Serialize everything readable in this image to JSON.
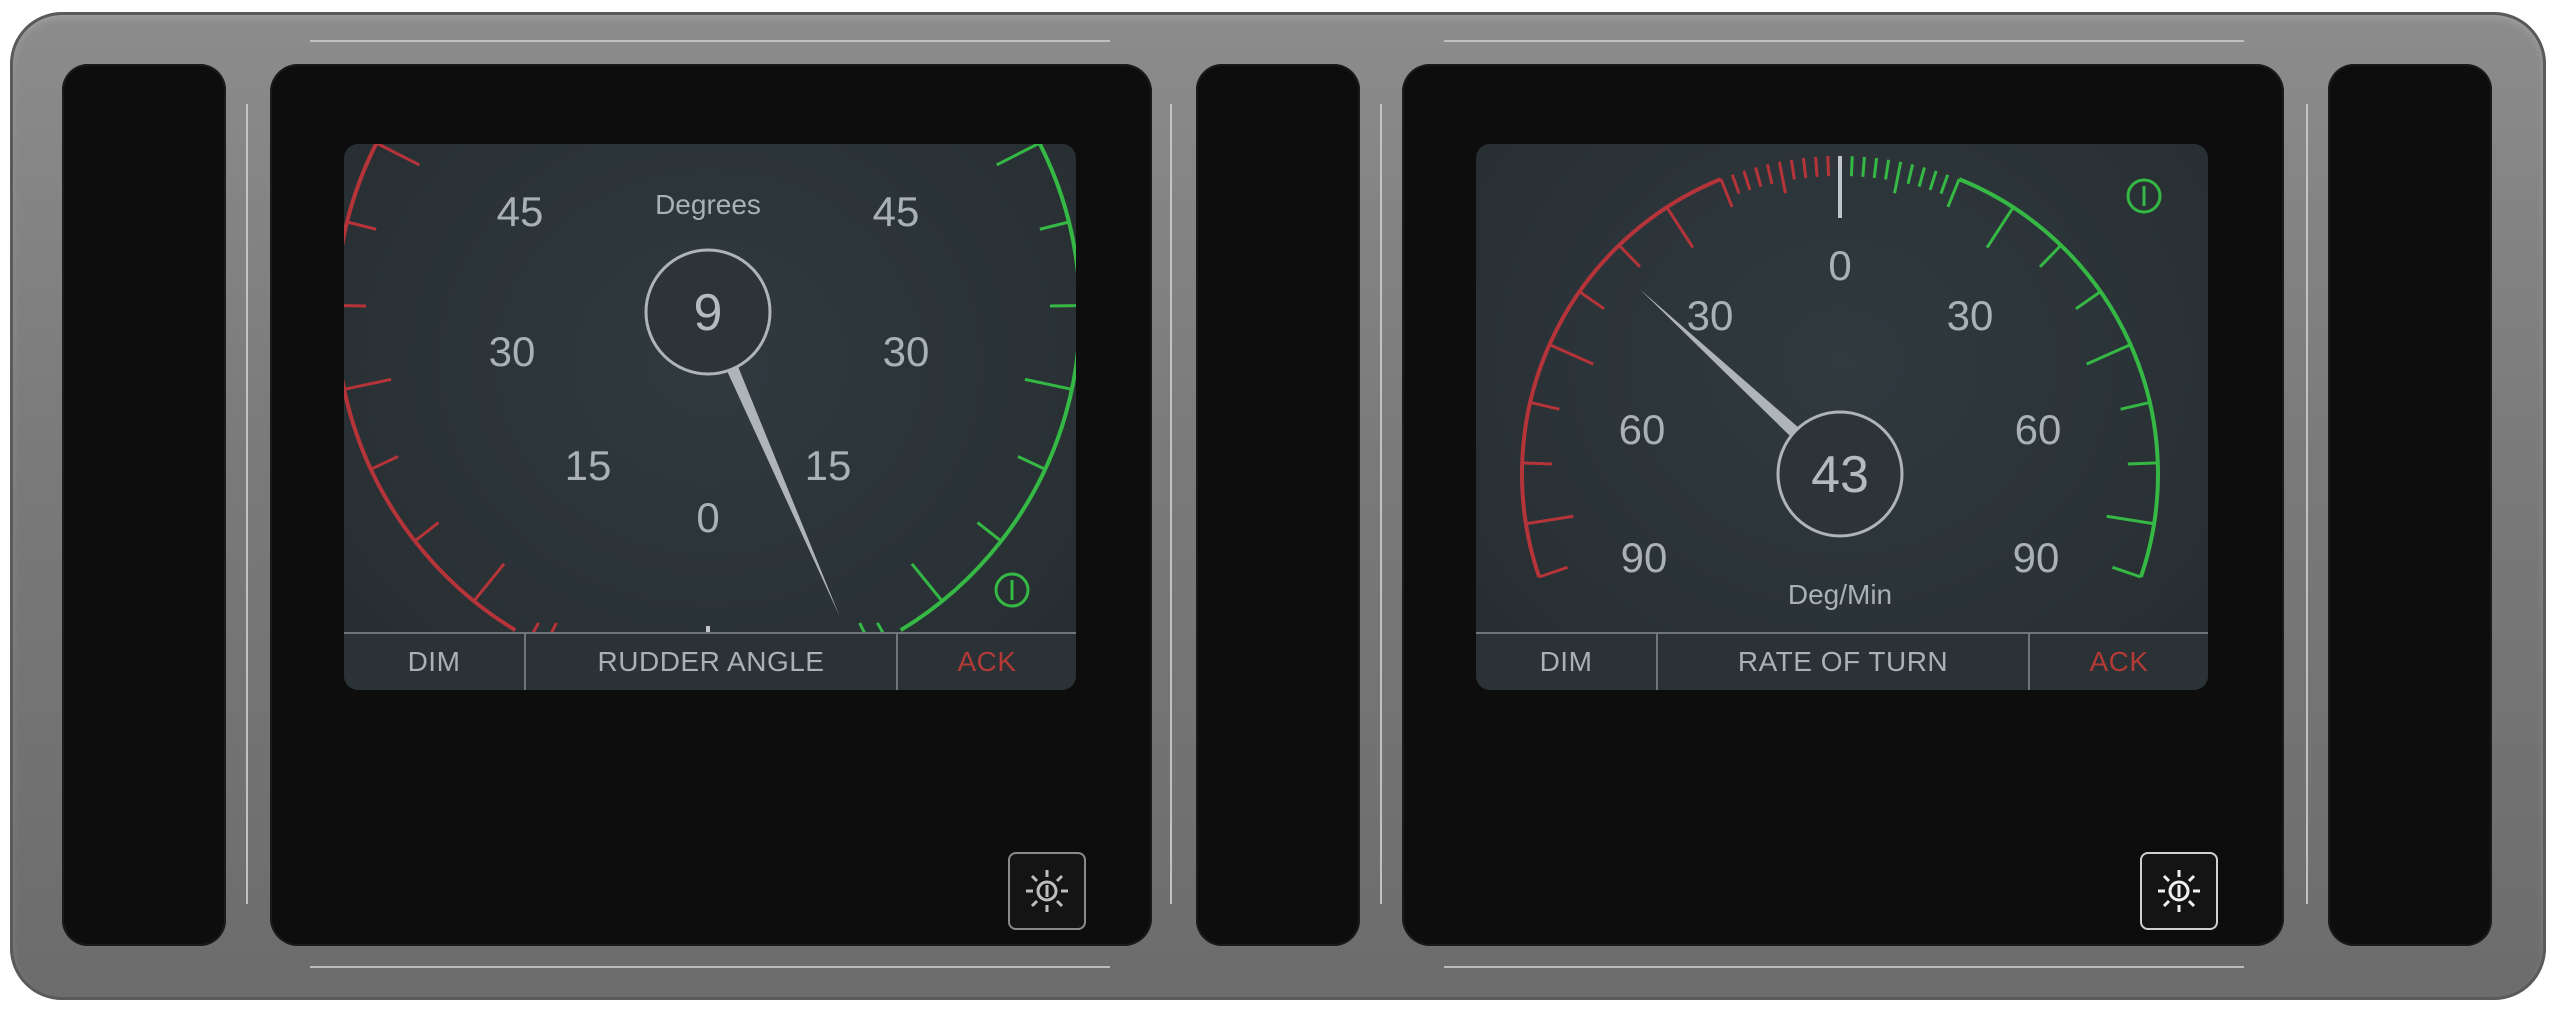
{
  "left": {
    "unit_label": "Degrees",
    "value": "9",
    "scale_labels": [
      "45",
      "30",
      "15",
      "0",
      "15",
      "30",
      "45"
    ],
    "softkeys": {
      "dim": "DIM",
      "title": "RUDDER ANGLE",
      "ack": "ACK"
    },
    "colors": {
      "port": "#b5343a",
      "starboard": "#35b844",
      "needle": "#aeb4b7"
    }
  },
  "right": {
    "unit_label": "Deg/Min",
    "value": "43",
    "scale_labels": [
      "90",
      "60",
      "30",
      "0",
      "30",
      "60",
      "90"
    ],
    "softkeys": {
      "dim": "DIM",
      "title": "RATE OF TURN",
      "ack": "ACK"
    },
    "colors": {
      "port": "#b5343a",
      "starboard": "#35b844",
      "needle": "#aeb4b7"
    }
  },
  "icons": {
    "power_indicator": "power-icon",
    "brightness": "sun-icon"
  }
}
